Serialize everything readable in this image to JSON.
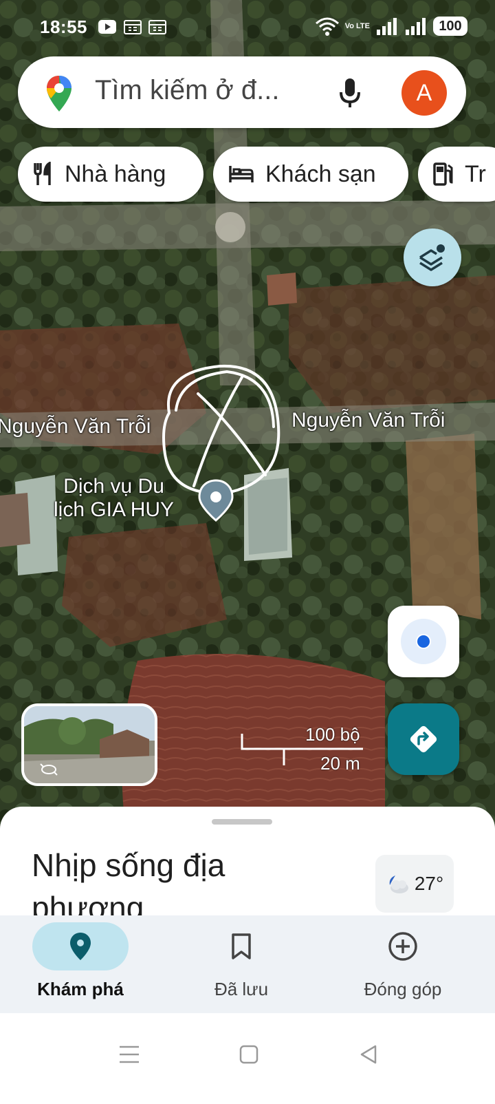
{
  "status_bar": {
    "time": "18:55",
    "network_label": "Vo LTE",
    "battery": "100"
  },
  "search": {
    "placeholder": "Tìm kiếm ở đ...",
    "avatar_letter": "A"
  },
  "chips": [
    {
      "label": "Nhà hàng",
      "icon": "restaurant-icon"
    },
    {
      "label": "Khách sạn",
      "icon": "hotel-icon"
    },
    {
      "label": "Tr",
      "icon": "gas-station-icon"
    }
  ],
  "map": {
    "street_name_left": "Nguyễn Văn Trỗi",
    "street_name_right": "Nguyễn Văn Trỗi",
    "poi_line1": "Dịch vụ Du",
    "poi_line2": "lịch GIA HUY",
    "scale_imperial": "100 bộ",
    "scale_metric": "20 m"
  },
  "sheet": {
    "title": "Nhịp sống địa phương",
    "temperature": "27°"
  },
  "bottom_nav": [
    {
      "label": "Khám phá",
      "icon": "explore-pin-icon",
      "active": true
    },
    {
      "label": "Đã lưu",
      "icon": "bookmark-icon",
      "active": false
    },
    {
      "label": "Đóng góp",
      "icon": "add-circle-icon",
      "active": false
    }
  ],
  "colors": {
    "accent_teal": "#0b7a88",
    "avatar": "#e8501c",
    "location_blue": "#1a66e0",
    "active_pill": "#bfe4ef"
  }
}
